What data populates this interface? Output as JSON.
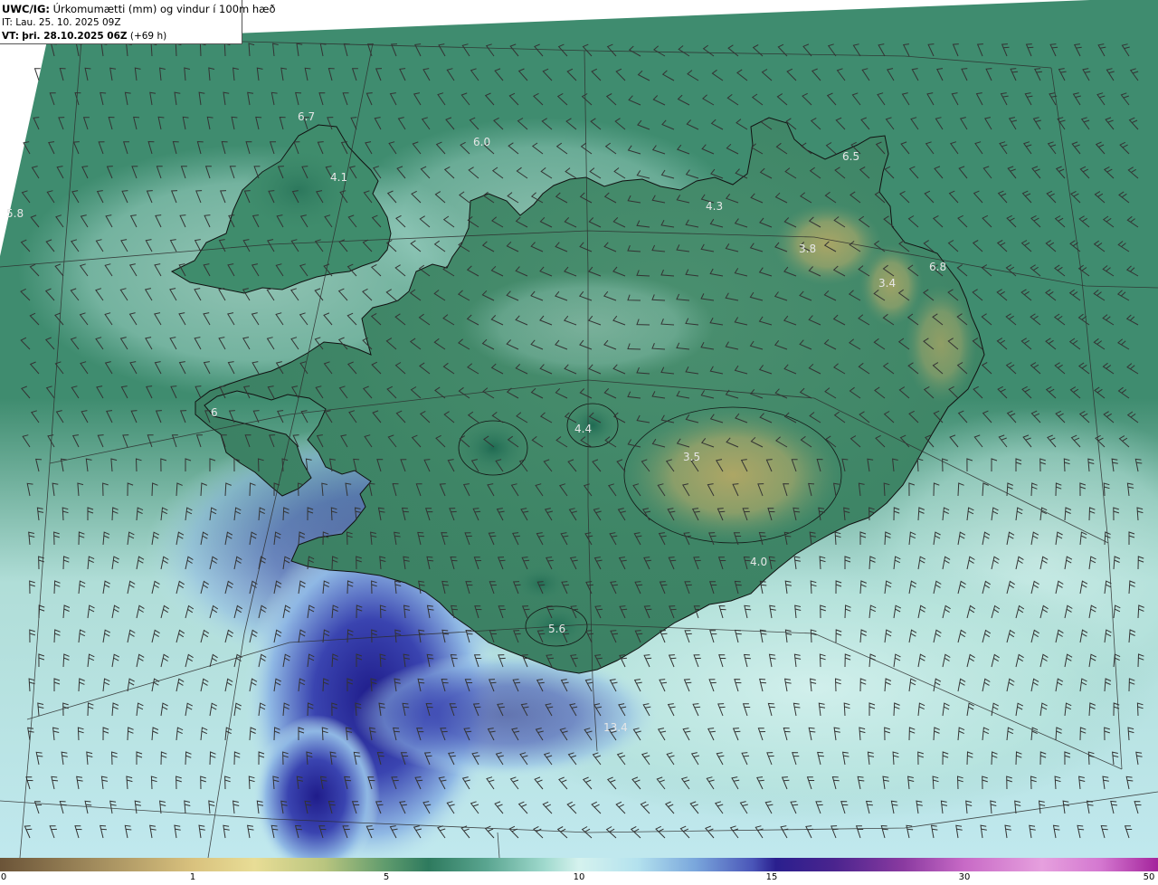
{
  "header": {
    "product": "UWC/IG:",
    "title_rest": "Úrkomumætti (mm) og vindur í 100m hæð",
    "it_prefix": "IT:",
    "it_value": "Lau. 25. 10. 2025 09Z",
    "vt_prefix": "VT:",
    "vt_value": "þri. 28.10.2025 06Z",
    "vt_lead": "(+69 h)"
  },
  "colorbar": {
    "ticks": [
      "0",
      "1",
      "5",
      "10",
      "15",
      "30",
      "50"
    ],
    "colors": {
      "dry": "#6b5438",
      "low": "#d9c27e",
      "mid": "#2e7a5e",
      "ten": "#d5f2ee",
      "fifteen": "#2a1f8e",
      "high": "#c86ac6",
      "max": "#a4249c"
    }
  },
  "map": {
    "field_labels": [
      {
        "text": "6.7"
      },
      {
        "text": "6.0"
      },
      {
        "text": "4.1"
      },
      {
        "text": "5.8"
      },
      {
        "text": "6.5"
      },
      {
        "text": "4.3"
      },
      {
        "text": "3.8"
      },
      {
        "text": "6.8"
      },
      {
        "text": "3.4"
      },
      {
        "text": "4.4"
      },
      {
        "text": "6"
      },
      {
        "text": "3.5"
      },
      {
        "text": "4.0"
      },
      {
        "text": "5.6"
      },
      {
        "text": "13.4"
      }
    ],
    "colors": {
      "land_green": "#3f8a6c",
      "sea_teal": "#4f9a82",
      "glacier_yellow": "#a3a466",
      "heavy_precip_blue": "#2f2f9f",
      "light_cyan": "#c8ece6",
      "barb_color": "#333333",
      "coast_color": "#111111",
      "label_color": "#e6e6e6"
    }
  }
}
